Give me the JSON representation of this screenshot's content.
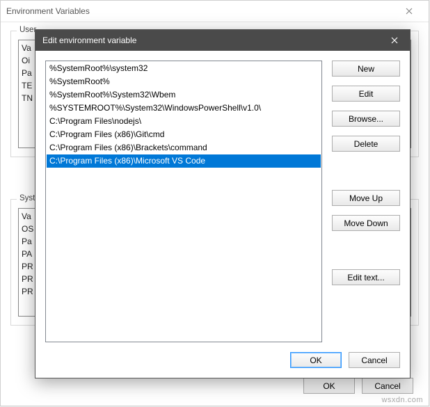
{
  "bg_window": {
    "title": "Environment Variables",
    "section_user_label": "User",
    "section_system_label": "Syste",
    "user_rows": [
      "Va",
      "Oi",
      "Pa",
      "TE",
      "TN"
    ],
    "system_rows": [
      "Va",
      "OS",
      "Pa",
      "PA",
      "PR",
      "PR",
      "PR"
    ],
    "ok_label": "OK",
    "cancel_label": "Cancel"
  },
  "dlg": {
    "title": "Edit environment variable",
    "paths": [
      "%SystemRoot%\\system32",
      "%SystemRoot%",
      "%SystemRoot%\\System32\\Wbem",
      "%SYSTEMROOT%\\System32\\WindowsPowerShell\\v1.0\\",
      "C:\\Program Files\\nodejs\\",
      "C:\\Program Files (x86)\\Git\\cmd",
      "C:\\Program Files (x86)\\Brackets\\command",
      "C:\\Program Files (x86)\\Microsoft VS Code"
    ],
    "selected_index": 7,
    "buttons": {
      "new": "New",
      "edit": "Edit",
      "browse": "Browse...",
      "delete": "Delete",
      "move_up": "Move Up",
      "move_down": "Move Down",
      "edit_text": "Edit text..."
    },
    "ok_label": "OK",
    "cancel_label": "Cancel"
  },
  "watermark": "wsxdn.com"
}
